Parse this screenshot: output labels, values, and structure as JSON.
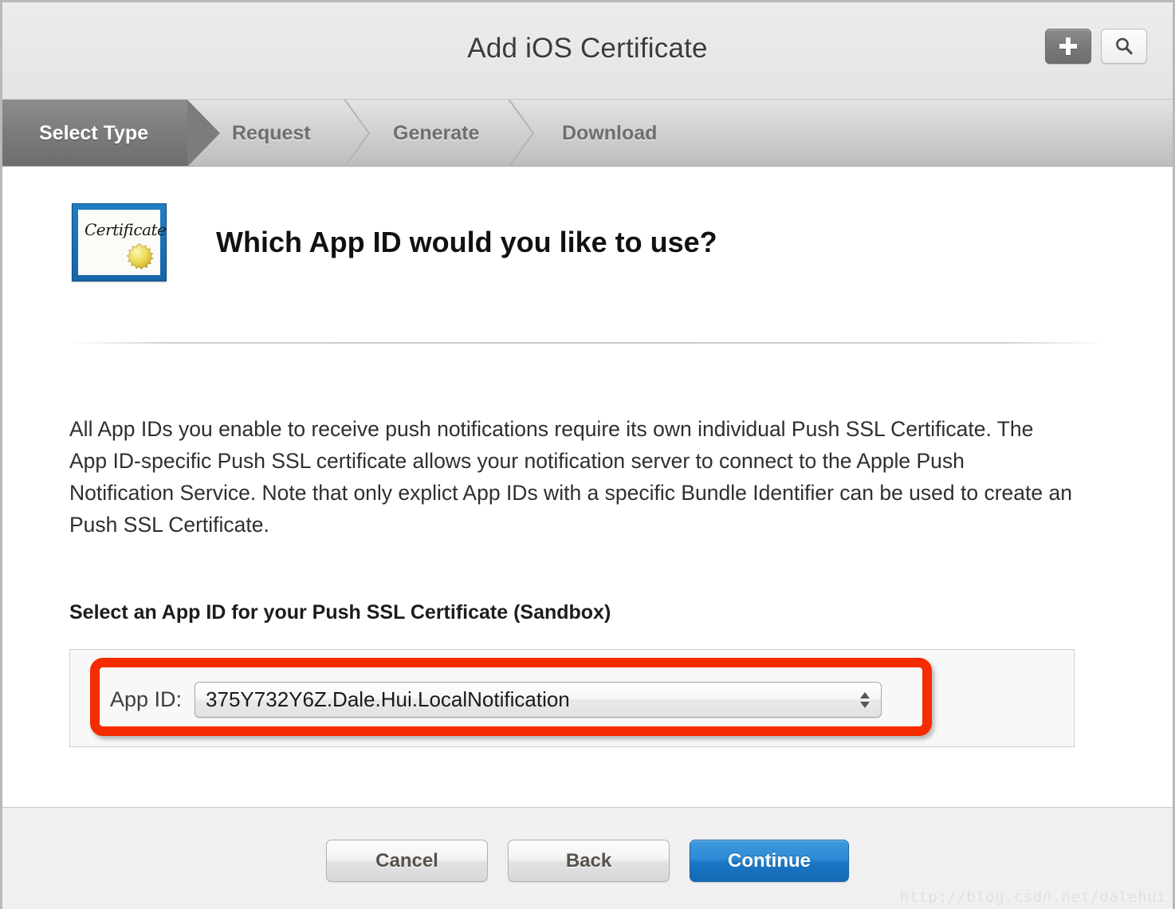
{
  "window": {
    "title": "Add iOS Certificate",
    "add_button_icon": "plus-icon",
    "search_button_icon": "search-icon"
  },
  "steps": [
    {
      "label": "Select Type",
      "state": "active"
    },
    {
      "label": "Request",
      "state": "inactive"
    },
    {
      "label": "Generate",
      "state": "inactive"
    },
    {
      "label": "Download",
      "state": "inactive"
    }
  ],
  "content": {
    "cert_icon_text": "Certificate",
    "heading": "Which App ID would you like to use?",
    "body": "All App IDs you enable to receive push notifications require its own individual Push SSL Certificate. The App ID-specific Push SSL certificate allows your notification server to connect to the Apple Push Notification Service. Note that only explict App IDs with a specific Bundle Identifier can be used to create an Push SSL Certificate.",
    "select_section_label": "Select an App ID for your Push SSL Certificate (Sandbox)",
    "appid_label": "App ID:",
    "appid_value": "375Y732Y6Z.Dale.Hui.LocalNotification",
    "appid_options": [
      "375Y732Y6Z.Dale.Hui.LocalNotification"
    ],
    "annotation_color": "#f52c00"
  },
  "footer": {
    "cancel_label": "Cancel",
    "back_label": "Back",
    "continue_label": "Continue",
    "continue_color": "#1a76c4"
  },
  "watermark": "http://blog.csdn.net/dalehui"
}
